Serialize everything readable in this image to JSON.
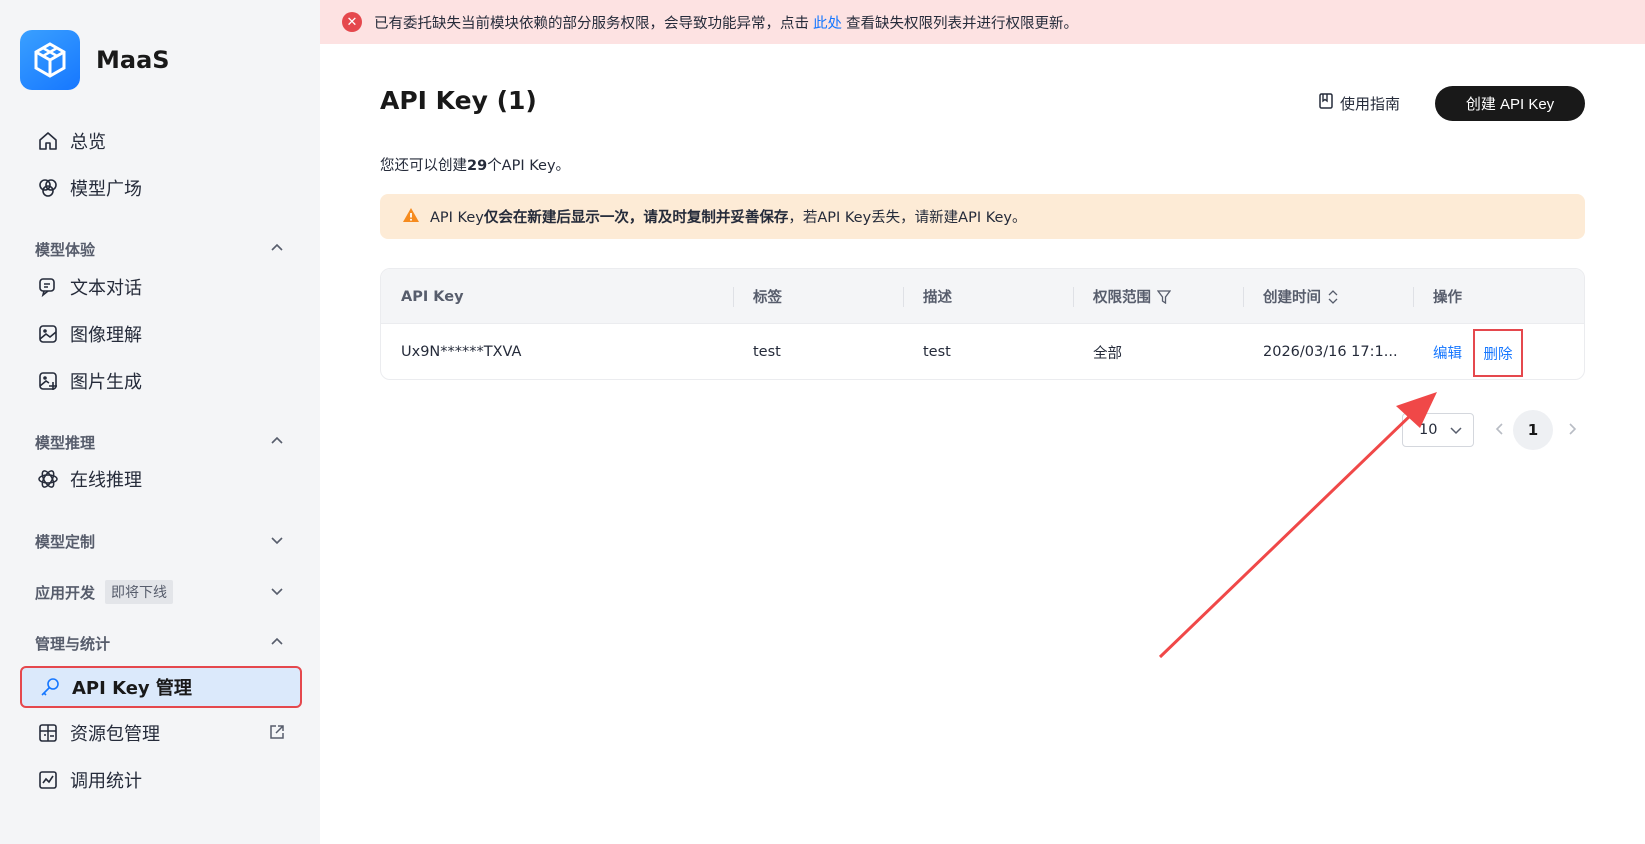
{
  "app": {
    "name": "MaaS"
  },
  "sidebar": {
    "top_items": [
      {
        "label": "总览",
        "icon": "home-icon"
      },
      {
        "label": "模型广场",
        "icon": "cube-icon"
      }
    ],
    "groups": [
      {
        "label": "模型体验",
        "expanded": true,
        "items": [
          {
            "label": "文本对话",
            "icon": "chat-icon"
          },
          {
            "label": "图像理解",
            "icon": "image-icon"
          },
          {
            "label": "图片生成",
            "icon": "image-plus-icon"
          }
        ]
      },
      {
        "label": "模型推理",
        "expanded": true,
        "items": [
          {
            "label": "在线推理",
            "icon": "atom-icon"
          }
        ]
      },
      {
        "label": "模型定制",
        "expanded": false,
        "items": []
      },
      {
        "label": "应用开发",
        "badge": "即将下线",
        "expanded": false,
        "items": []
      },
      {
        "label": "管理与统计",
        "expanded": true,
        "items": [
          {
            "label": "API Key 管理",
            "icon": "key-icon",
            "active": true
          },
          {
            "label": "资源包管理",
            "icon": "package-icon",
            "external": true
          },
          {
            "label": "调用统计",
            "icon": "chart-icon"
          }
        ]
      }
    ]
  },
  "banner": {
    "text_before": "已有委托缺失当前模块依赖的部分服务权限，会导致功能异常，点击",
    "link": "此处",
    "text_after": "查看缺失权限列表并进行权限更新。",
    "color": "#e5484d"
  },
  "header": {
    "title": "API Key (1)",
    "guide_label": "使用指南",
    "create_label": "创建 API Key"
  },
  "quota": {
    "prefix": "您还可以创建",
    "count": "29",
    "suffix": "个API Key。"
  },
  "warning": {
    "p1": "API Key",
    "bold": "仅会在新建后显示一次，请及时复制并妥善保存",
    "p2": "，若API Key丢失，请新建API Key。"
  },
  "table": {
    "columns": [
      "API Key",
      "标签",
      "描述",
      "权限范围",
      "创建时间",
      "操作"
    ],
    "rows": [
      {
        "key": "Ux9N******TXVA",
        "tag": "test",
        "desc": "test",
        "scope": "全部",
        "created": "2026/03/16 17:1...",
        "edit": "编辑",
        "delete": "删除"
      }
    ]
  },
  "pagination": {
    "page_size": "10",
    "current_page": "1"
  },
  "colors": {
    "accent": "#1677ff",
    "highlight": "#e5484d",
    "sidebar_bg": "#f4f5f7"
  }
}
